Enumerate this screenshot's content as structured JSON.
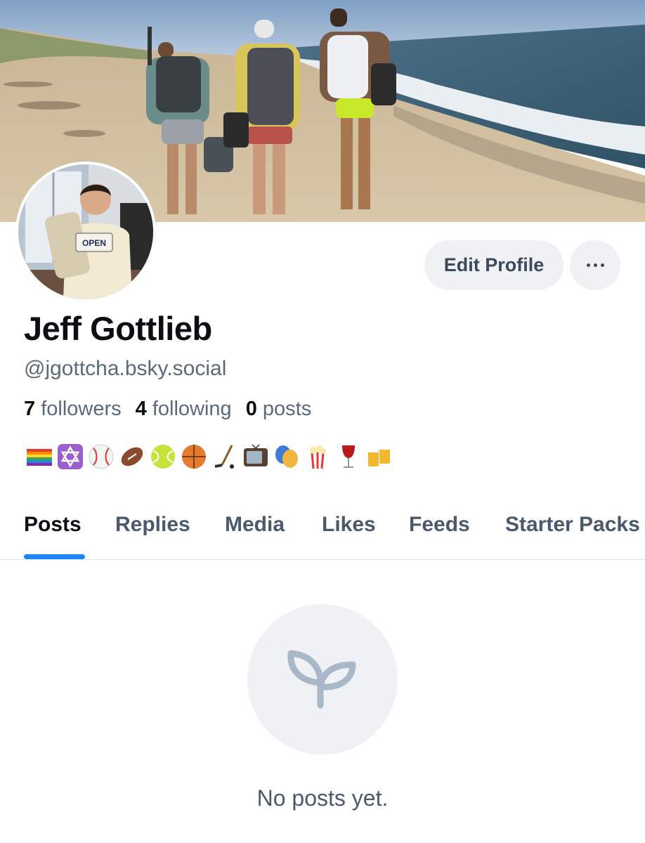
{
  "profile": {
    "display_name": "Jeff Gottlieb",
    "handle": "@jgottcha.bsky.social",
    "stats": {
      "followers_count": "7",
      "followers_label": "followers",
      "following_count": "4",
      "following_label": "following",
      "posts_count": "0",
      "posts_label": "posts"
    },
    "bio_emoji": [
      "rainbow-flag",
      "star-of-david",
      "baseball",
      "american-football",
      "tennis-ball",
      "basketball",
      "hockey-stick",
      "television",
      "performing-arts",
      "popcorn",
      "wine-glass",
      "beer-mugs"
    ]
  },
  "header": {
    "edit_profile_label": "Edit Profile",
    "more_icon": "ellipsis-icon"
  },
  "tabs": [
    {
      "label": "Posts",
      "active": true
    },
    {
      "label": "Replies",
      "active": false
    },
    {
      "label": "Media",
      "active": false
    },
    {
      "label": "Likes",
      "active": false
    },
    {
      "label": "Feeds",
      "active": false
    },
    {
      "label": "Starter Packs",
      "active": false
    }
  ],
  "empty_state": {
    "icon": "sprout-icon",
    "message": "No posts yet."
  },
  "colors": {
    "accent": "#1a83ff",
    "muted_text": "#5a6a7c",
    "button_bg": "#eff1f4"
  }
}
